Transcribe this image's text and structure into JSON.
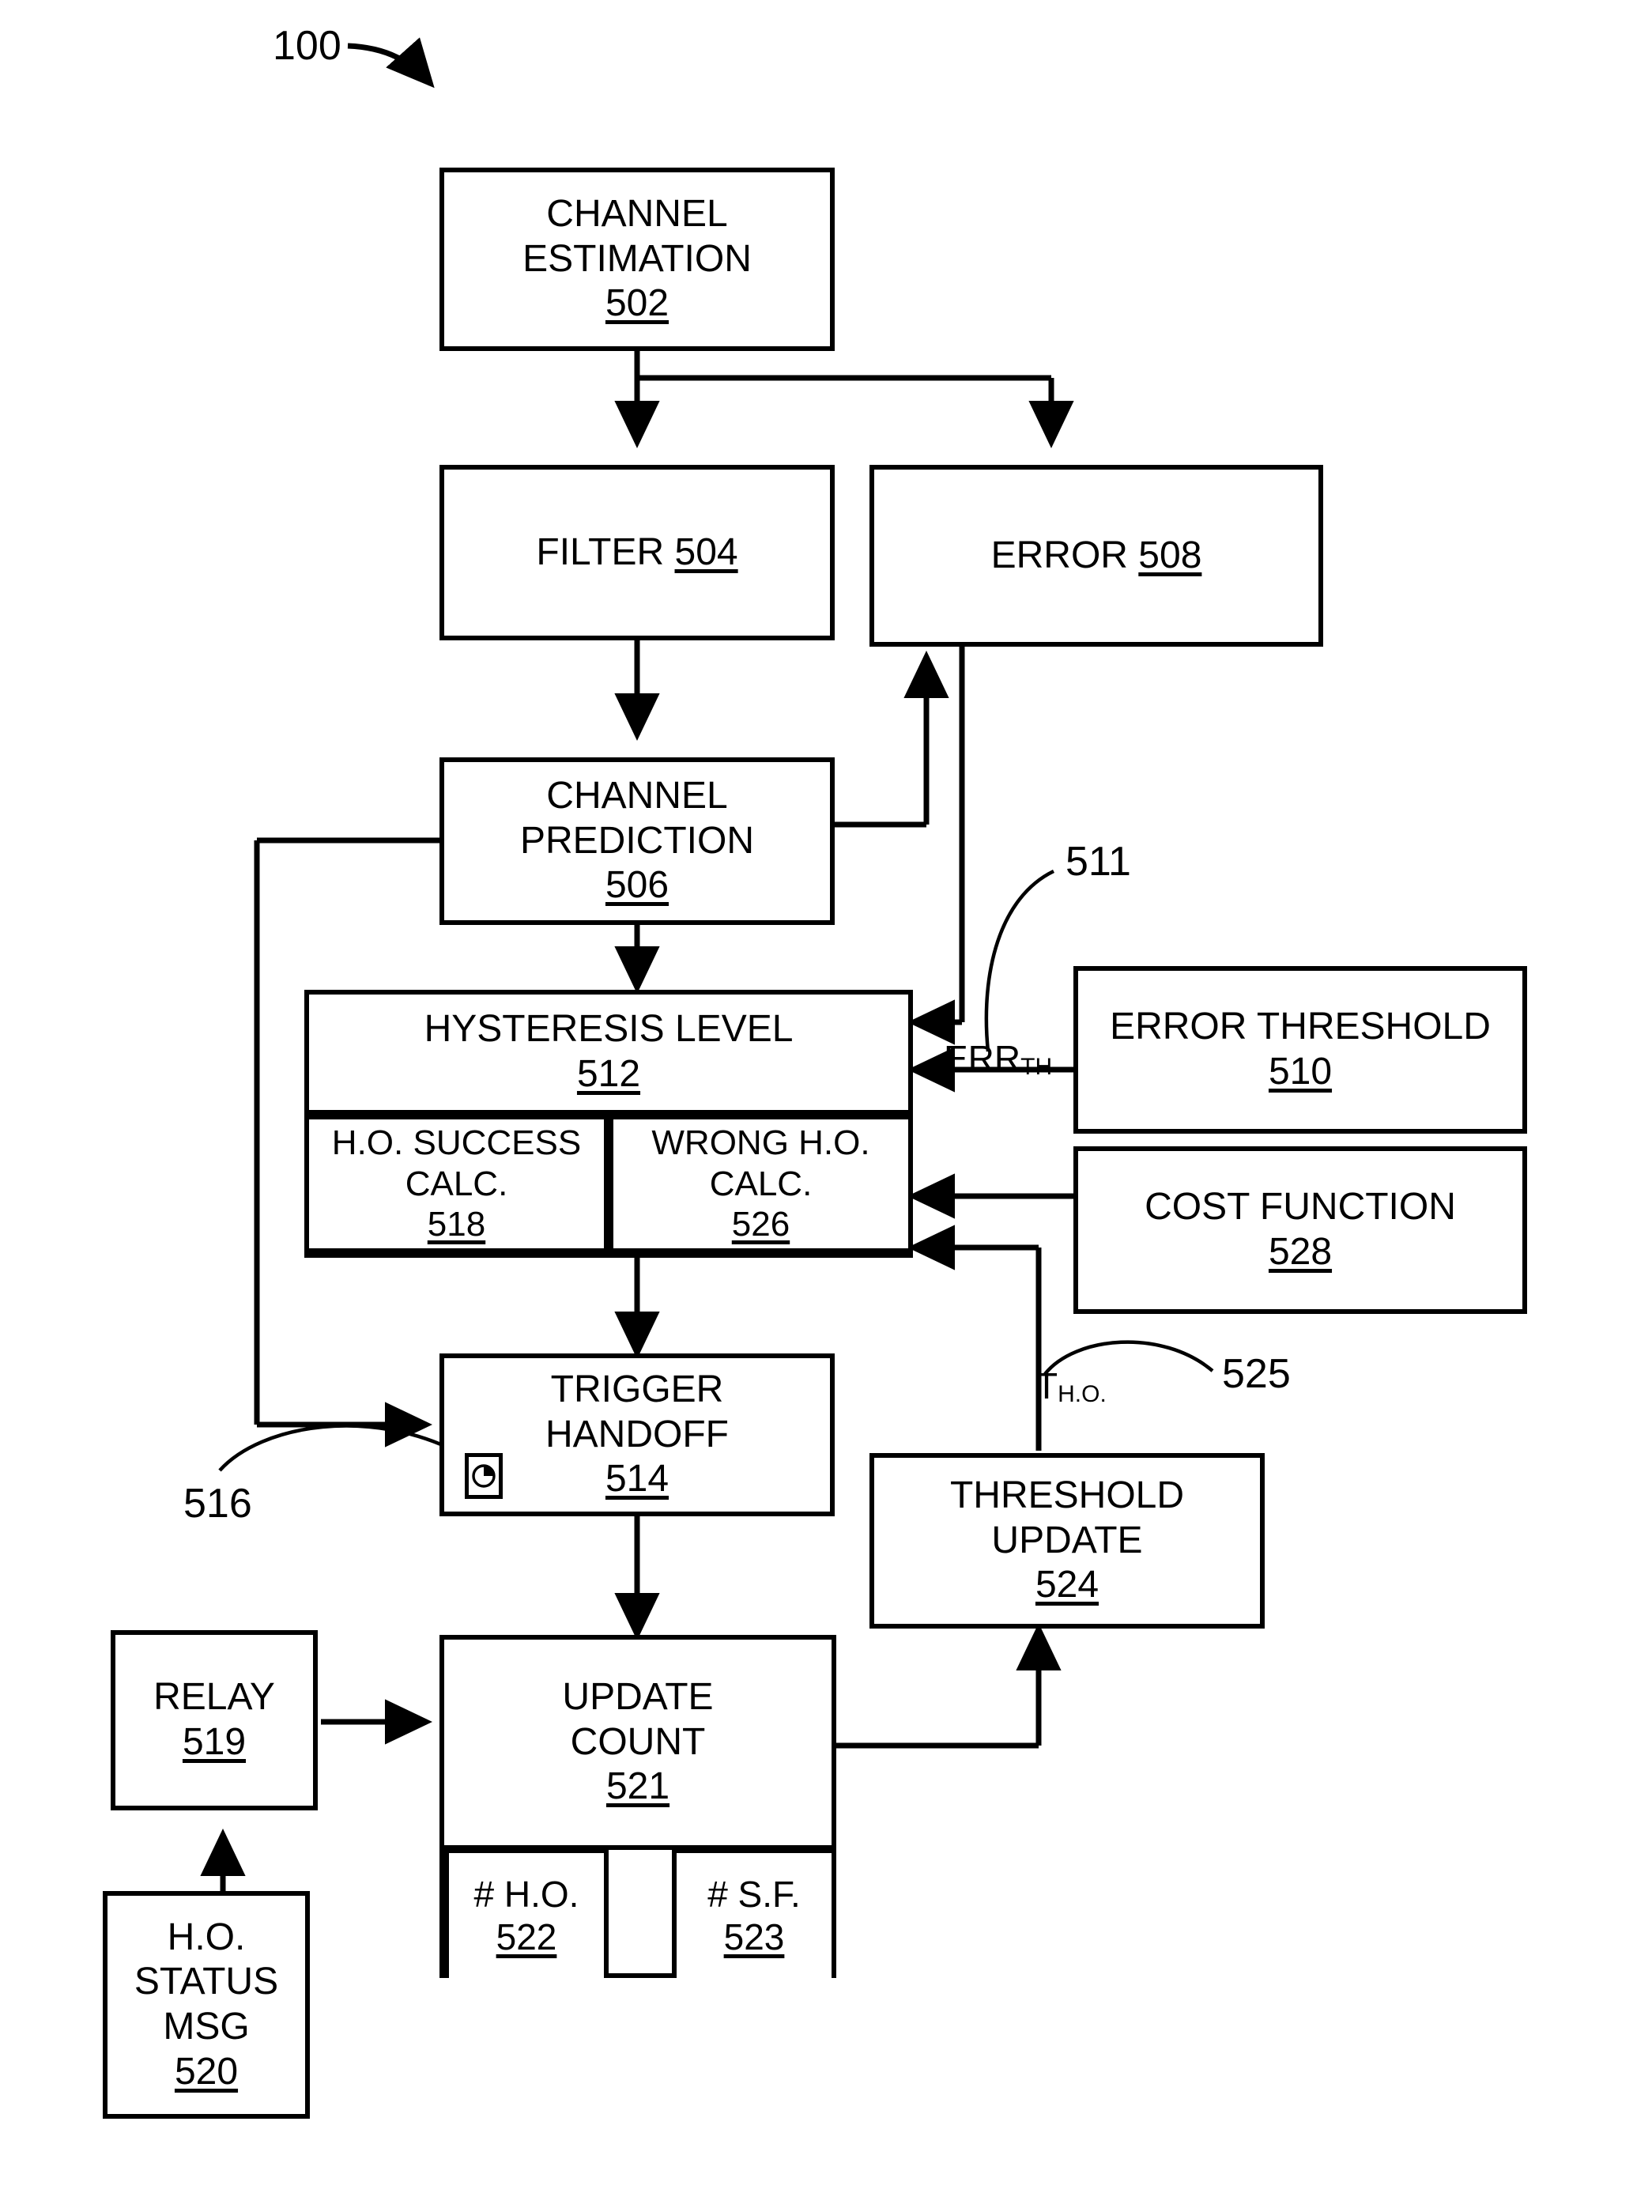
{
  "figure": {
    "label": "100"
  },
  "blocks": {
    "channel_estimation": {
      "line1": "CHANNEL",
      "line2": "ESTIMATION",
      "num": "502"
    },
    "filter": {
      "line1": "FILTER",
      "num": "504"
    },
    "error": {
      "line1": "ERROR",
      "num": "508"
    },
    "channel_prediction": {
      "line1": "CHANNEL",
      "line2": "PREDICTION",
      "num": "506"
    },
    "hysteresis_level": {
      "line1": "HYSTERESIS LEVEL",
      "num": "512"
    },
    "ho_success_calc": {
      "line1": "H.O. SUCCESS",
      "line2": "CALC.",
      "num": "518"
    },
    "wrong_ho_calc": {
      "line1": "WRONG H.O.",
      "line2": "CALC.",
      "num": "526"
    },
    "error_threshold": {
      "line1": "ERROR THRESHOLD",
      "num": "510"
    },
    "cost_function": {
      "line1": "COST FUNCTION",
      "num": "528"
    },
    "trigger_handoff": {
      "line1": "TRIGGER",
      "line2": "HANDOFF",
      "num": "514"
    },
    "threshold_update": {
      "line1": "THRESHOLD",
      "line2": "UPDATE",
      "num": "524"
    },
    "update_count": {
      "line1": "UPDATE",
      "line2": "COUNT",
      "num": "521"
    },
    "num_ho": {
      "line1": "# H.O.",
      "num": "522"
    },
    "num_sf": {
      "line1": "# S.F.",
      "num": "523"
    },
    "relay": {
      "line1": "RELAY",
      "num": "519"
    },
    "ho_status_msg": {
      "line1": "H.O.",
      "line2": "STATUS",
      "line3": "MSG",
      "num": "520"
    }
  },
  "annotations": {
    "ref_511": "511",
    "ref_516": "516",
    "ref_525": "525",
    "err_th_base": "ERR",
    "err_th_sub": "TH",
    "t_ho_base": "T",
    "t_ho_sub": "H.O."
  },
  "icons": {
    "timer": "clock-icon"
  },
  "colors": {
    "line": "#000000",
    "background": "#ffffff"
  }
}
